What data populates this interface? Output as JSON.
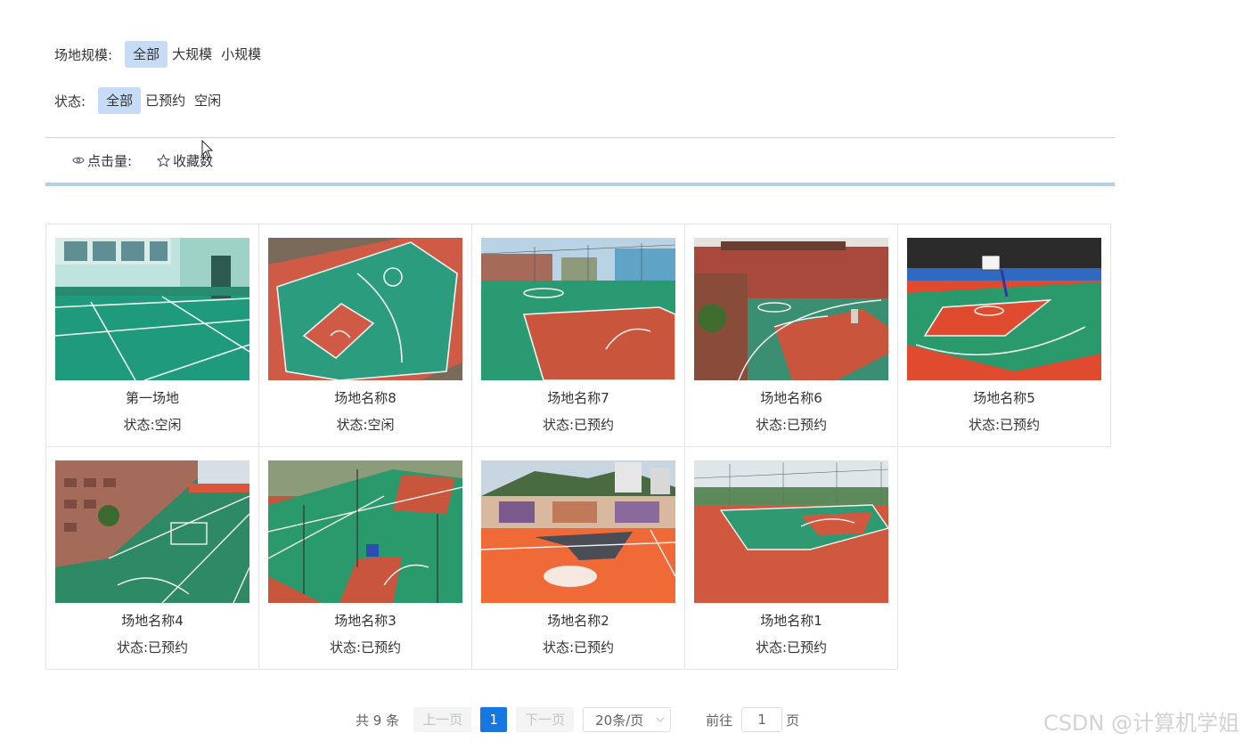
{
  "filters": {
    "scale": {
      "label": "场地规模:",
      "options": [
        "全部",
        "大规模",
        "小规模"
      ],
      "selected": "全部"
    },
    "status": {
      "label": "状态:",
      "options": [
        "全部",
        "已预约",
        "空闲"
      ],
      "selected": "全部"
    }
  },
  "sort": {
    "clicks_label": "点击量:",
    "favorites_label": "收藏数"
  },
  "venues": [
    {
      "name": "第一场地",
      "status": "状态:空闲"
    },
    {
      "name": "场地名称8",
      "status": "状态:空闲"
    },
    {
      "name": "场地名称7",
      "status": "状态:已预约"
    },
    {
      "name": "场地名称6",
      "status": "状态:已预约"
    },
    {
      "name": "场地名称5",
      "status": "状态:已预约"
    },
    {
      "name": "场地名称4",
      "status": "状态:已预约"
    },
    {
      "name": "场地名称3",
      "status": "状态:已预约"
    },
    {
      "name": "场地名称2",
      "status": "状态:已预约"
    },
    {
      "name": "场地名称1",
      "status": "状态:已预约"
    }
  ],
  "pagination": {
    "total": "共 9 条",
    "prev": "上一页",
    "current_page": "1",
    "next": "下一页",
    "page_size": "20条/页",
    "goto_prefix": "前往",
    "goto_value": "1",
    "goto_suffix": "页"
  },
  "watermark": "CSDN @计算机学姐",
  "colors": {
    "active_filter_bg": "#c6dcf6",
    "accent_line": "#b3d0ea",
    "current_page_bg": "#1677e0"
  }
}
